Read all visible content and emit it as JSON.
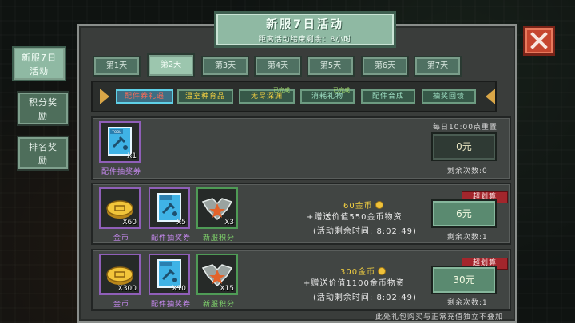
{
  "header": {
    "title": "新服7日活动",
    "countdown": "距离活动结束剩余：8小时"
  },
  "side_menu": [
    {
      "label": "新服7日\n活动",
      "active": true
    },
    {
      "label": "积分奖\n励",
      "active": false
    },
    {
      "label": "排名奖\n励",
      "active": false
    }
  ],
  "day_tabs": [
    "第1天",
    "第2天",
    "第3天",
    "第4天",
    "第5天",
    "第6天",
    "第7天"
  ],
  "active_day_index": 1,
  "sub_tabs": [
    {
      "label": "配件券礼遇",
      "active": true,
      "badge": ""
    },
    {
      "label": "温室种育品",
      "active": false,
      "badge": ""
    },
    {
      "label": "无尽深渊",
      "active": false,
      "badge": "已完成"
    },
    {
      "label": "消耗礼物",
      "active": false,
      "badge": "已完成"
    },
    {
      "label": "配件合成",
      "active": false,
      "badge": ""
    },
    {
      "label": "抽奖回馈",
      "active": false,
      "badge": ""
    }
  ],
  "packages": [
    {
      "items": [
        {
          "name": "配件抽奖券",
          "count": "X1",
          "icon": "ticket-icon",
          "frame_color": "#8f5fb8"
        }
      ],
      "reset_note": "每日10:00点重置",
      "price": "0元",
      "remaining": "剩余次数:0",
      "tag": "",
      "gold_amount": "",
      "bonus_text": "",
      "activity_time": ""
    },
    {
      "items": [
        {
          "name": "金币",
          "count": "X60",
          "icon": "gold-coin-icon",
          "frame_color": "#8f5fb8"
        },
        {
          "name": "配件抽奖券",
          "count": "X5",
          "icon": "ticket-icon",
          "frame_color": "#8f5fb8"
        },
        {
          "name": "新服积分",
          "count": "X3",
          "icon": "wing-emblem-icon",
          "frame_color": "#4f9b56"
        }
      ],
      "reset_note": "",
      "price": "6元",
      "remaining": "剩余次数:1",
      "tag": "超划算",
      "gold_amount": "60金币",
      "bonus_text": "+赠送价值550金币物资",
      "activity_time": "(活动剩余时间: 8:02:49)"
    },
    {
      "items": [
        {
          "name": "金币",
          "count": "X300",
          "icon": "gold-coin-icon",
          "frame_color": "#8f5fb8"
        },
        {
          "name": "配件抽奖券",
          "count": "X10",
          "icon": "ticket-icon",
          "frame_color": "#8f5fb8"
        },
        {
          "name": "新服积分",
          "count": "X15",
          "icon": "wing-emblem-icon",
          "frame_color": "#4f9b56"
        }
      ],
      "reset_note": "",
      "price": "30元",
      "remaining": "剩余次数:1",
      "tag": "超划算",
      "gold_amount": "300金币",
      "bonus_text": "+赠送价值1100金币物资",
      "activity_time": "(活动剩余时间: 8:02:49)"
    }
  ],
  "footer_note": "此处礼包购买与正常充值独立不叠加",
  "colors": {
    "accent_green": "#8fb9a3",
    "close_red": "#c6462f",
    "tag_red": "#a3262c",
    "gold": "#f3d041",
    "active_subtab_border": "#5fd1e8"
  }
}
